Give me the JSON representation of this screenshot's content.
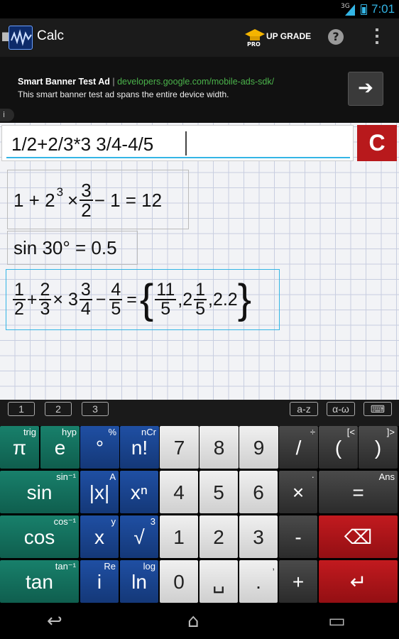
{
  "status_bar": {
    "network": "3G",
    "time": "7:01"
  },
  "action_bar": {
    "title": "Calc",
    "upgrade_label": "UP GRADE",
    "pro_label": "PRO",
    "help_icon": "?"
  },
  "ad": {
    "title": "Smart Banner Test Ad",
    "separator": "|",
    "url": "developers.google.com/mobile-ads-sdk/",
    "description": "This smart banner test ad spans the entire device width.",
    "arrow": "➔",
    "info": "i"
  },
  "input": {
    "expression": "1/2+2/3*3 3/4-4/5",
    "clear_label": "C"
  },
  "history": [
    {
      "expr": "1 + 2",
      "sup": "3",
      "times": "×",
      "num": "3",
      "den": "2",
      "rest": "− 1 = 12"
    },
    {
      "text": "sin 30° = 0.5"
    },
    {
      "a_num": "1",
      "a_den": "2",
      "plus": "+",
      "b_num": "2",
      "b_den": "3",
      "times": "× 3",
      "c_num": "3",
      "c_den": "4",
      "minus": "−",
      "d_num": "4",
      "d_den": "5",
      "eq": "=",
      "r1_num": "11",
      "r1_den": "5",
      "r2_whole": "2",
      "r2_num": "1",
      "r2_den": "5",
      "r3": "2.2"
    }
  ],
  "keyboard_tabs": [
    "1",
    "2",
    "3",
    "a-z",
    "α-ω",
    "⌨"
  ],
  "keys": [
    {
      "row": 0,
      "col": 0,
      "label": "π",
      "sup": "trig",
      "color": "teal"
    },
    {
      "row": 0,
      "col": 1,
      "label": "e",
      "sup": "hyp",
      "color": "teal"
    },
    {
      "row": 0,
      "col": 2,
      "label": "°",
      "sup": "%",
      "color": "blue"
    },
    {
      "row": 0,
      "col": 3,
      "label": "n!",
      "sup": "nCr",
      "color": "blue"
    },
    {
      "row": 0,
      "col": 4,
      "label": "7",
      "sup": "",
      "color": "white"
    },
    {
      "row": 0,
      "col": 5,
      "label": "8",
      "sup": "",
      "color": "white"
    },
    {
      "row": 0,
      "col": 6,
      "label": "9",
      "sup": "",
      "color": "white"
    },
    {
      "row": 0,
      "col": 7,
      "label": "/",
      "sup": "÷",
      "color": "dark"
    },
    {
      "row": 0,
      "col": 8,
      "label": "(",
      "sup": "[<",
      "color": "dark"
    },
    {
      "row": 0,
      "col": 9,
      "label": ")",
      "sup": "]>",
      "color": "dark"
    },
    {
      "row": 1,
      "col": 0,
      "label": "sin",
      "sup": "sin⁻¹",
      "color": "teal"
    },
    {
      "row": 1,
      "col": 1,
      "label": "|x|",
      "sup": "A",
      "color": "blue"
    },
    {
      "row": 1,
      "col": 2,
      "label": "xⁿ",
      "sup": "",
      "color": "blue"
    },
    {
      "row": 1,
      "col": 3,
      "label": "4",
      "sup": "",
      "color": "white"
    },
    {
      "row": 1,
      "col": 4,
      "label": "5",
      "sup": "",
      "color": "white"
    },
    {
      "row": 1,
      "col": 5,
      "label": "6",
      "sup": "",
      "color": "white"
    },
    {
      "row": 1,
      "col": 6,
      "label": "×",
      "sup": "·",
      "color": "dark"
    },
    {
      "row": 1,
      "col": 7,
      "label": "=",
      "sup": "Ans",
      "color": "dark"
    },
    {
      "row": 2,
      "col": 0,
      "label": "cos",
      "sup": "cos⁻¹",
      "color": "teal"
    },
    {
      "row": 2,
      "col": 1,
      "label": "x",
      "sup": "y",
      "color": "blue"
    },
    {
      "row": 2,
      "col": 2,
      "label": "√",
      "sup": "3",
      "color": "blue"
    },
    {
      "row": 2,
      "col": 3,
      "label": "1",
      "sup": "",
      "color": "white"
    },
    {
      "row": 2,
      "col": 4,
      "label": "2",
      "sup": "",
      "color": "white"
    },
    {
      "row": 2,
      "col": 5,
      "label": "3",
      "sup": "",
      "color": "white"
    },
    {
      "row": 2,
      "col": 6,
      "label": "-",
      "sup": "",
      "color": "dark"
    },
    {
      "row": 2,
      "col": 7,
      "label": "⌫",
      "sup": "",
      "color": "red"
    },
    {
      "row": 3,
      "col": 0,
      "label": "tan",
      "sup": "tan⁻¹",
      "color": "teal"
    },
    {
      "row": 3,
      "col": 1,
      "label": "i",
      "sup": "Re",
      "color": "blue"
    },
    {
      "row": 3,
      "col": 2,
      "label": "ln",
      "sup": "log",
      "color": "blue"
    },
    {
      "row": 3,
      "col": 3,
      "label": "0",
      "sup": "",
      "color": "white"
    },
    {
      "row": 3,
      "col": 4,
      "label": "␣",
      "sup": "",
      "color": "white"
    },
    {
      "row": 3,
      "col": 5,
      "label": ".",
      "sup": ",",
      "color": "white"
    },
    {
      "row": 3,
      "col": 6,
      "label": "+",
      "sup": "",
      "color": "dark"
    },
    {
      "row": 3,
      "col": 7,
      "label": "↵",
      "sup": "",
      "color": "red"
    }
  ],
  "nav": {
    "back": "↩",
    "home": "⌂",
    "recents": "▭"
  }
}
